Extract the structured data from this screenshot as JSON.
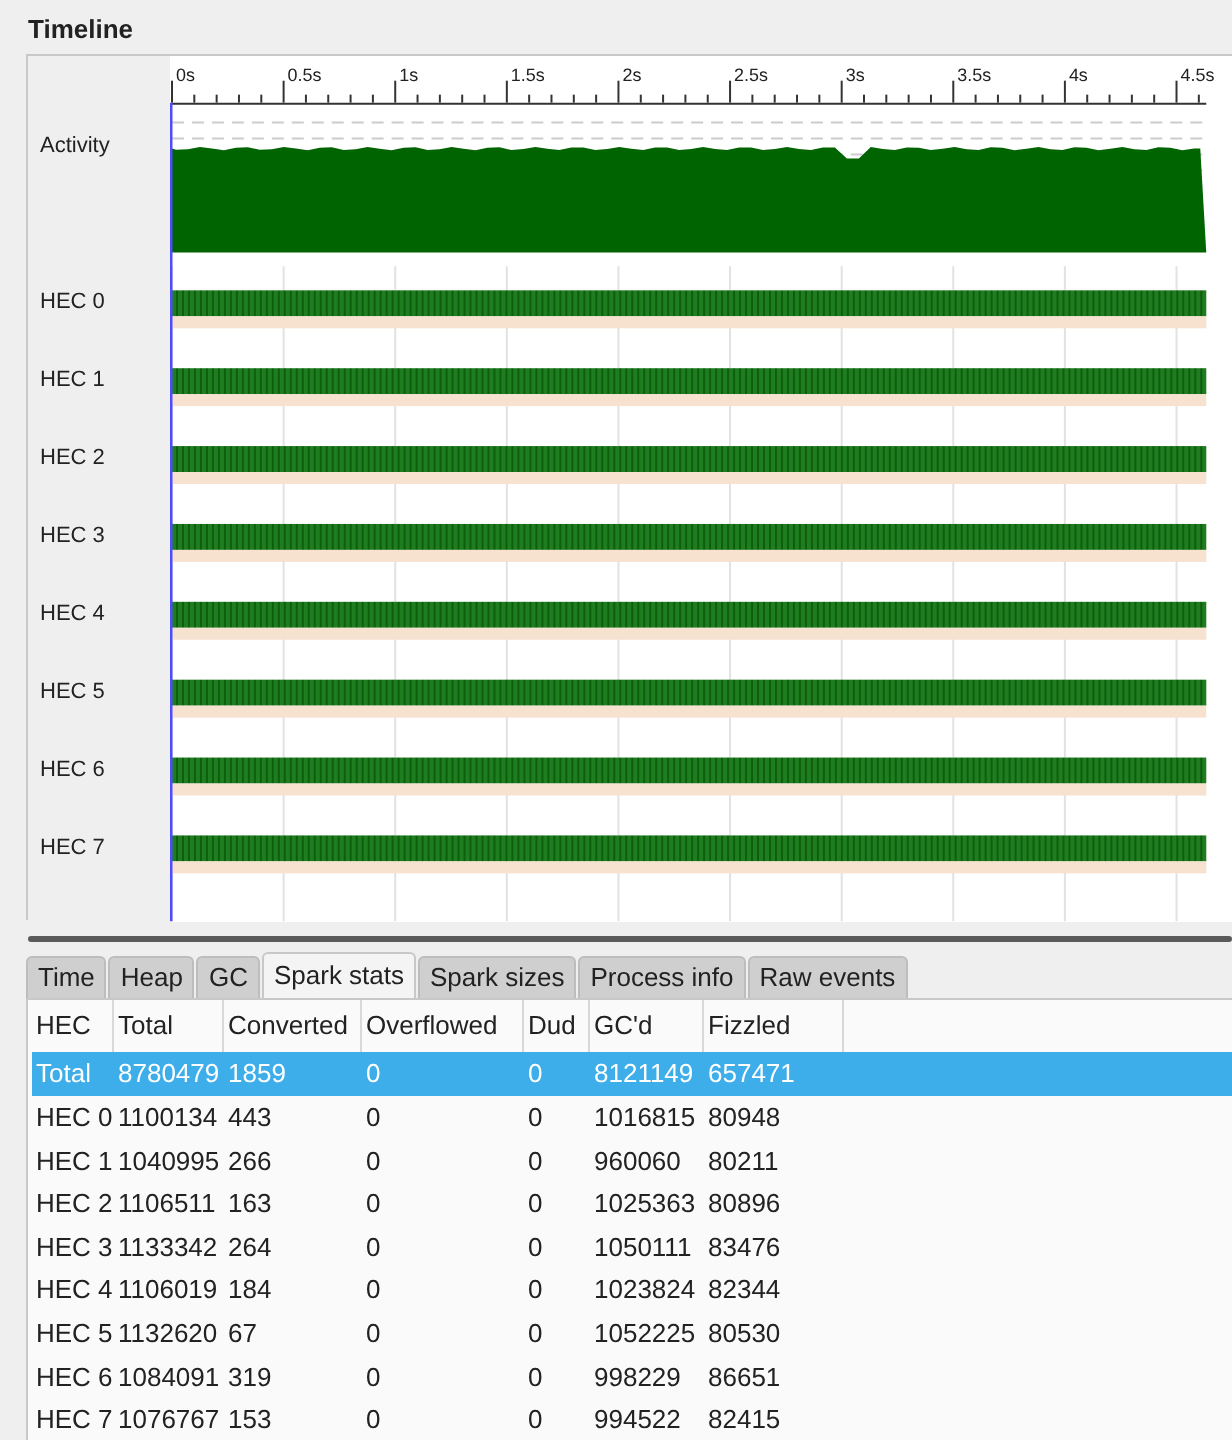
{
  "title": "Timeline",
  "timeline": {
    "ticks": [
      "0s",
      "0.5s",
      "1s",
      "1.5s",
      "2s",
      "2.5s",
      "3s",
      "3.5s",
      "4s",
      "4.5s"
    ],
    "activity": {
      "label": "Activity"
    },
    "hecs": [
      {
        "label": "HEC 0"
      },
      {
        "label": "HEC 1"
      },
      {
        "label": "HEC 2"
      },
      {
        "label": "HEC 3"
      },
      {
        "label": "HEC 4"
      },
      {
        "label": "HEC 5"
      },
      {
        "label": "HEC 6"
      },
      {
        "label": "HEC 7"
      }
    ]
  },
  "tabs": [
    {
      "label": "Time",
      "selected": false
    },
    {
      "label": "Heap",
      "selected": false
    },
    {
      "label": "GC",
      "selected": false
    },
    {
      "label": "Spark stats",
      "selected": true
    },
    {
      "label": "Spark sizes",
      "selected": false
    },
    {
      "label": "Process info",
      "selected": false
    },
    {
      "label": "Raw events",
      "selected": false
    }
  ],
  "table": {
    "columns": [
      "HEC",
      "Total",
      "Converted",
      "Overflowed",
      "Dud",
      "GC'd",
      "Fizzled"
    ],
    "rows": [
      {
        "cells": [
          "Total",
          "8780479",
          "1859",
          "0",
          "0",
          "8121149",
          "657471"
        ],
        "selected": true
      },
      {
        "cells": [
          "HEC 0",
          "1100134",
          "443",
          "0",
          "0",
          "1016815",
          "80948"
        ],
        "selected": false
      },
      {
        "cells": [
          "HEC 1",
          "1040995",
          "266",
          "0",
          "0",
          "960060",
          "80211"
        ],
        "selected": false
      },
      {
        "cells": [
          "HEC 2",
          "1106511",
          "163",
          "0",
          "0",
          "1025363",
          "80896"
        ],
        "selected": false
      },
      {
        "cells": [
          "HEC 3",
          "1133342",
          "264",
          "0",
          "0",
          "1050111",
          "83476"
        ],
        "selected": false
      },
      {
        "cells": [
          "HEC 4",
          "1106019",
          "184",
          "0",
          "0",
          "1023824",
          "82344"
        ],
        "selected": false
      },
      {
        "cells": [
          "HEC 5",
          "1132620",
          "67",
          "0",
          "0",
          "1052225",
          "80530"
        ],
        "selected": false
      },
      {
        "cells": [
          "HEC 6",
          "1084091",
          "319",
          "0",
          "0",
          "998229",
          "86651"
        ],
        "selected": false
      },
      {
        "cells": [
          "HEC 7",
          "1076767",
          "153",
          "0",
          "0",
          "994522",
          "82415"
        ],
        "selected": false
      }
    ]
  }
}
